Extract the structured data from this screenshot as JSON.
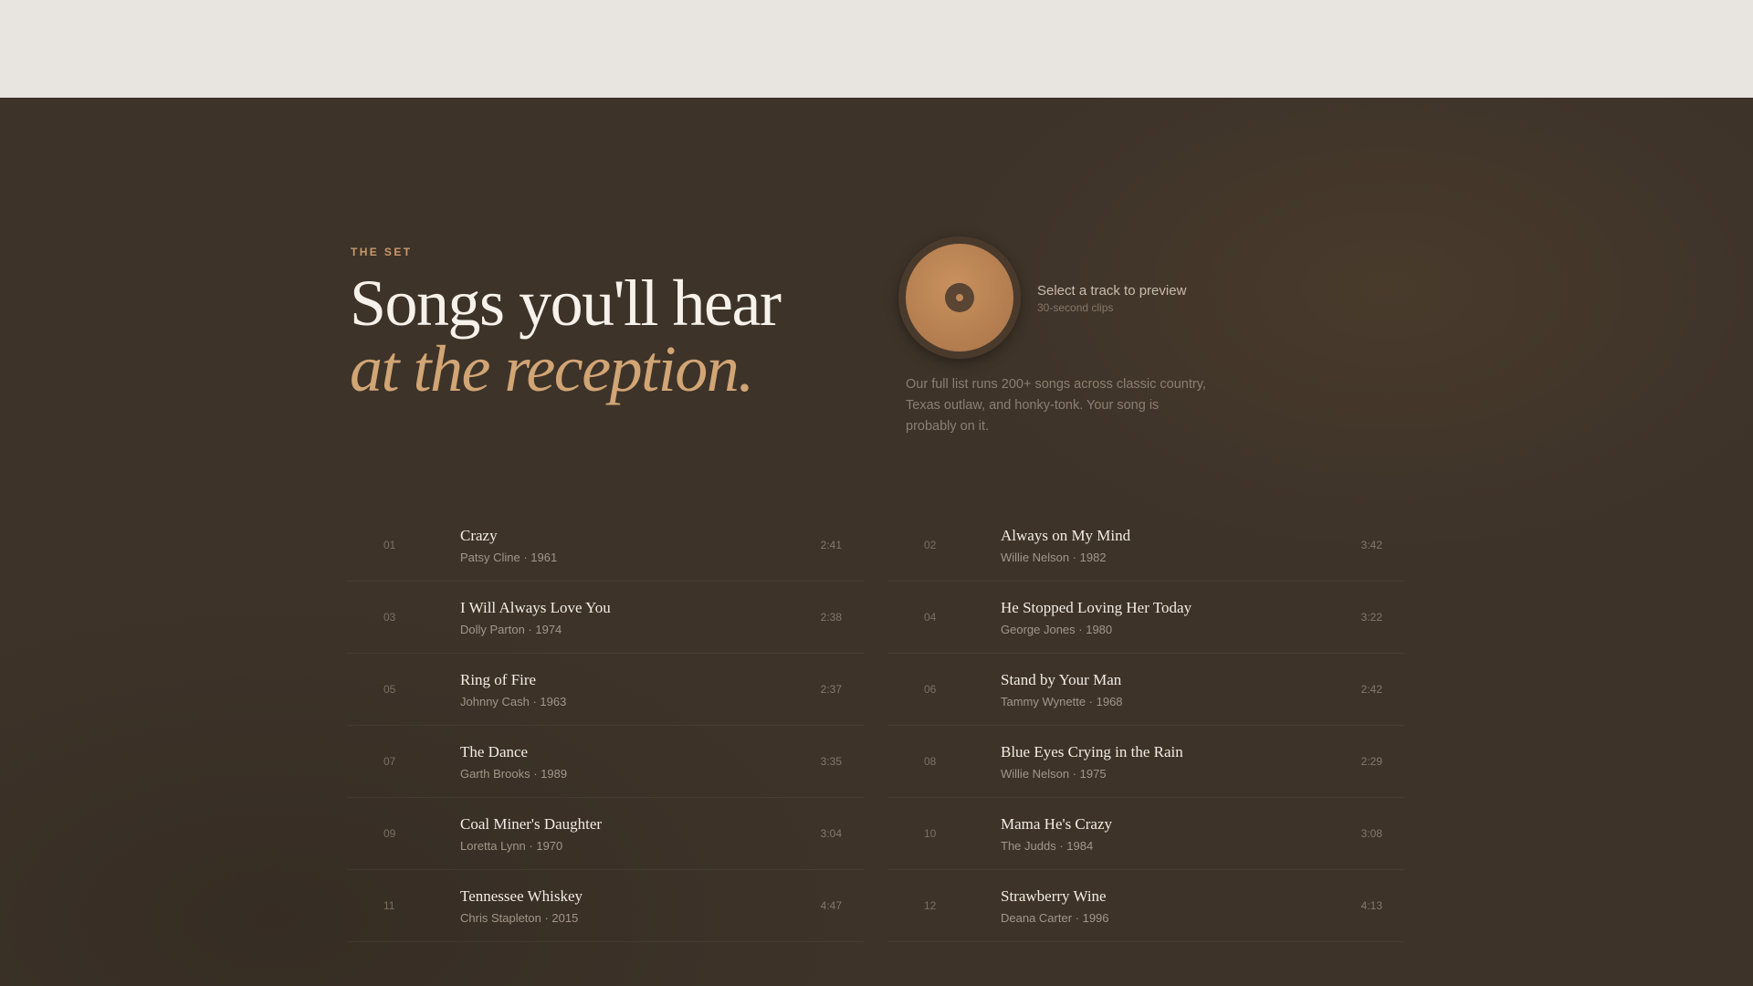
{
  "section": {
    "eyebrow": "THE SET",
    "title_line1": "Songs you'll hear",
    "title_line2": "at the reception."
  },
  "player": {
    "icon": "record-icon",
    "title": "Select a track to preview",
    "subtitle": "30-second clips"
  },
  "blurb": "Our full list runs 200+ songs across classic country, Texas outlaw, and honky-tonk. Your song is probably on it.",
  "colors": {
    "background": "#3d3329",
    "topbar": "#e8e5e0",
    "accent": "#d2a575",
    "heading": "#f6f1ea"
  },
  "tracks_left": [
    {
      "num": "01",
      "title": "Crazy",
      "meta": "Patsy Cline · 1961",
      "duration": "2:41"
    },
    {
      "num": "03",
      "title": "I Will Always Love You",
      "meta": "Dolly Parton · 1974",
      "duration": "2:38"
    },
    {
      "num": "05",
      "title": "Ring of Fire",
      "meta": "Johnny Cash · 1963",
      "duration": "2:37"
    },
    {
      "num": "07",
      "title": "The Dance",
      "meta": "Garth Brooks · 1989",
      "duration": "3:35"
    },
    {
      "num": "09",
      "title": "Coal Miner's Daughter",
      "meta": "Loretta Lynn · 1970",
      "duration": "3:04"
    },
    {
      "num": "11",
      "title": "Tennessee Whiskey",
      "meta": "Chris Stapleton · 2015",
      "duration": "4:47"
    }
  ],
  "tracks_right": [
    {
      "num": "02",
      "title": "Always on My Mind",
      "meta": "Willie Nelson · 1982",
      "duration": "3:42"
    },
    {
      "num": "04",
      "title": "He Stopped Loving Her Today",
      "meta": "George Jones · 1980",
      "duration": "3:22"
    },
    {
      "num": "06",
      "title": "Stand by Your Man",
      "meta": "Tammy Wynette · 1968",
      "duration": "2:42"
    },
    {
      "num": "08",
      "title": "Blue Eyes Crying in the Rain",
      "meta": "Willie Nelson · 1975",
      "duration": "2:29"
    },
    {
      "num": "10",
      "title": "Mama He's Crazy",
      "meta": "The Judds · 1984",
      "duration": "3:08"
    },
    {
      "num": "12",
      "title": "Strawberry Wine",
      "meta": "Deana Carter · 1996",
      "duration": "4:13"
    }
  ]
}
